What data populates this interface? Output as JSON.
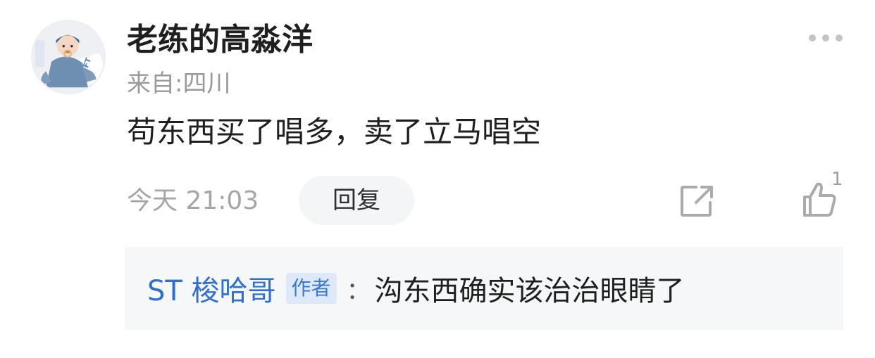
{
  "comment": {
    "username": "老练的高淼洋",
    "location": "来自:四川",
    "content": "苟东西买了唱多，卖了立马唱空",
    "timestamp": "今天 21:03",
    "reply_label": "回复",
    "like_count": "1",
    "icons": {
      "more": "more-dots-icon",
      "share": "share-icon",
      "like": "thumbs-up-icon"
    }
  },
  "sub_reply": {
    "author": "ST 梭哈哥",
    "badge": "作者",
    "separator": "：",
    "text": "沟东西确实该治治眼睛了"
  },
  "colors": {
    "username": "#1f1f1f",
    "meta_gray": "#9a9a9a",
    "link_blue": "#2e6fd0",
    "badge_bg": "#dde8f8",
    "reply_box_bg": "#f6f7f9",
    "reply_button_bg": "#f4f5f7"
  }
}
